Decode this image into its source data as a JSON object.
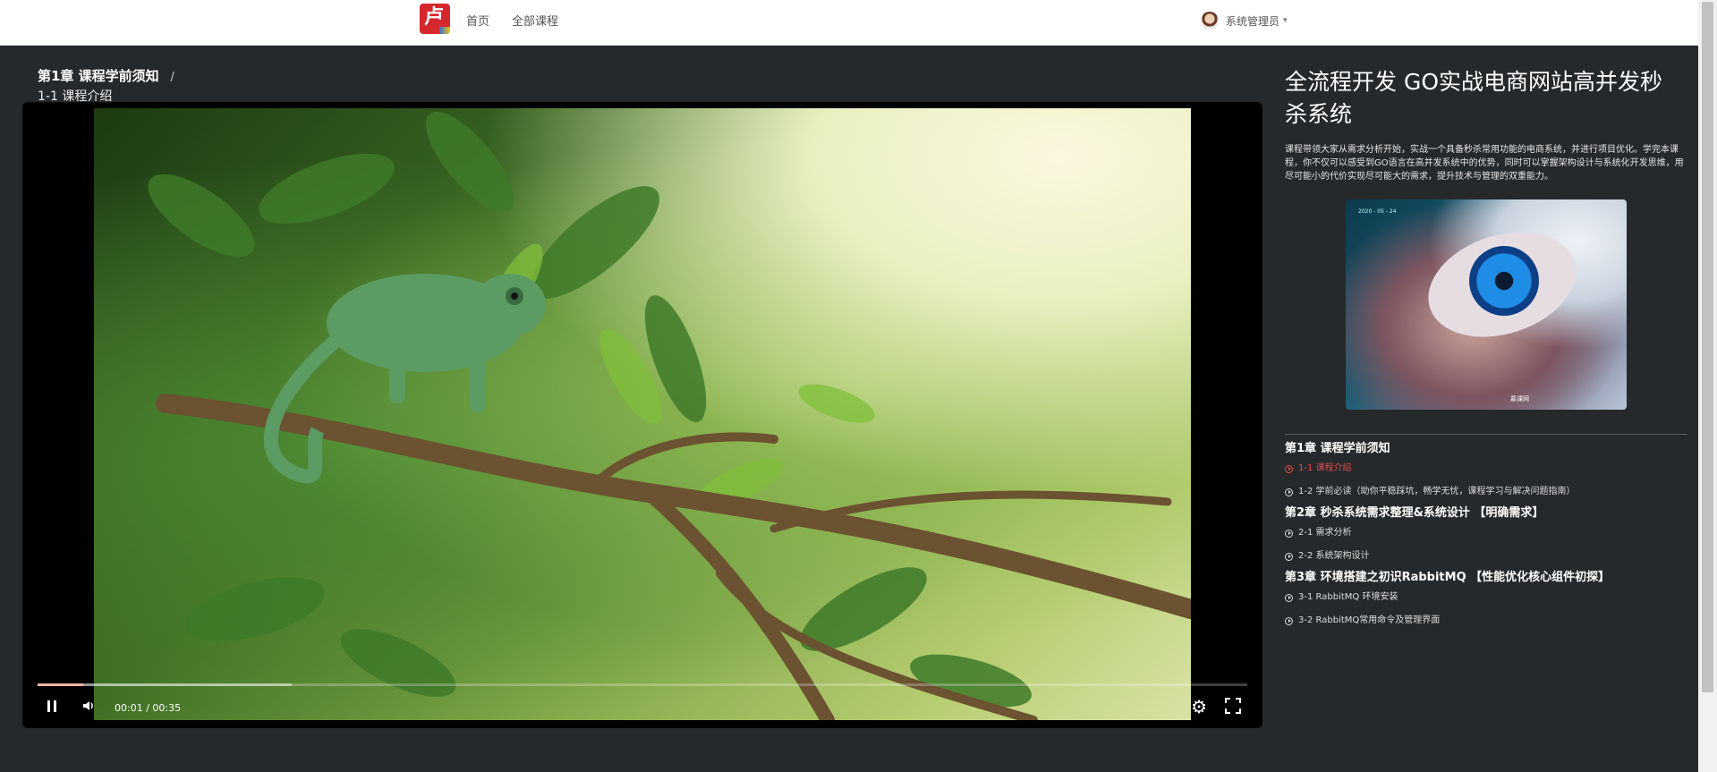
{
  "nav": {
    "logo_glyph": "卢",
    "home": "首页",
    "all_courses": "全部课程",
    "user_name": "系统管理员",
    "caret": "▾"
  },
  "breadcrumb": {
    "chapter": "第1章 课程学前须知",
    "separator": "/",
    "lesson": "1-1 课程介绍"
  },
  "player": {
    "current_time": "00:01",
    "duration": "00:35",
    "time_display": "00:01 / 00:35",
    "played_fraction": 0.038,
    "buffered_fraction": 0.21
  },
  "course": {
    "title": "全流程开发 GO实战电商网站高并发秒杀系统",
    "description": "课程带领大家从需求分析开始，实战一个具备秒杀常用功能的电商系统，并进行项目优化。学完本课程，你不仅可以感受到GO语言在高并发系统中的优势，同时可以掌握架构设计与系统化开发思维，用尽可能小的代价实现尽可能大的需求，提升技术与管理的双重能力。",
    "cover_badge": "慕课网",
    "cover_date": "2020 - 05 - 24"
  },
  "chapters": [
    {
      "title": "第1章 课程学前须知",
      "lessons": [
        {
          "label": "1-1 课程介绍",
          "active": true
        },
        {
          "label": "1-2 学前必读（助你平稳踩坑，畅学无忧，课程学习与解决问题指南）",
          "active": false
        }
      ]
    },
    {
      "title": "第2章 秒杀系统需求整理&系统设计 【明确需求】",
      "lessons": [
        {
          "label": "2-1 需求分析",
          "active": false
        },
        {
          "label": "2-2 系统架构设计",
          "active": false
        }
      ]
    },
    {
      "title": "第3章 环境搭建之初识RabbitMQ 【性能优化核心组件初探】",
      "lessons": [
        {
          "label": "3-1 RabbitMQ 环境安装",
          "active": false
        },
        {
          "label": "3-2 RabbitMQ常用命令及管理界面",
          "active": false
        }
      ]
    }
  ],
  "colors": {
    "page_bg": "#26292c",
    "accent_active": "#e24b4b",
    "logo_red": "#d5272e"
  }
}
